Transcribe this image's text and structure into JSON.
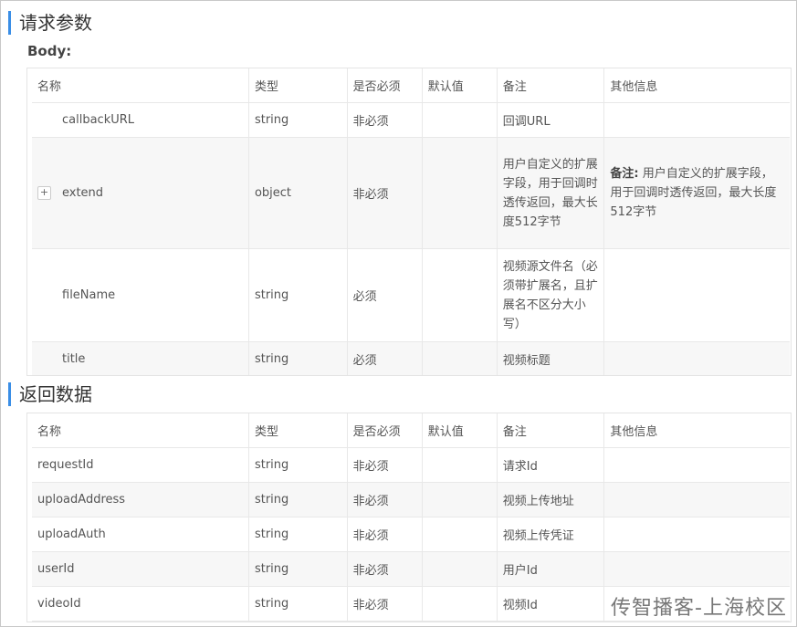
{
  "request": {
    "title": "请求参数",
    "body_label": "Body:",
    "headers": [
      "名称",
      "类型",
      "是否必须",
      "默认值",
      "备注",
      "其他信息"
    ],
    "rows": [
      {
        "name": "callbackURL",
        "type": "string",
        "required": "非必须",
        "default": "",
        "note": "回调URL",
        "other_label": "",
        "other": ""
      },
      {
        "name": "extend",
        "type": "object",
        "required": "非必须",
        "default": "",
        "note": "用户自定义的扩展字段，用于回调时透传返回，最大长度512字节",
        "other_label": "备注:",
        "other": " 用户自定义的扩展字段，用于回调时透传返回，最大长度512字节"
      },
      {
        "name": "fileName",
        "type": "string",
        "required": "必须",
        "default": "",
        "note": "视频源文件名（必须带扩展名，且扩展名不区分大小写）",
        "other_label": "",
        "other": ""
      },
      {
        "name": "title",
        "type": "string",
        "required": "必须",
        "default": "",
        "note": "视频标题",
        "other_label": "",
        "other": ""
      }
    ],
    "expand_symbol": "+"
  },
  "response": {
    "title": "返回数据",
    "headers": [
      "名称",
      "类型",
      "是否必须",
      "默认值",
      "备注",
      "其他信息"
    ],
    "rows": [
      {
        "name": "requestId",
        "type": "string",
        "required": "非必须",
        "default": "",
        "note": "请求Id",
        "other": ""
      },
      {
        "name": "uploadAddress",
        "type": "string",
        "required": "非必须",
        "default": "",
        "note": "视频上传地址",
        "other": ""
      },
      {
        "name": "uploadAuth",
        "type": "string",
        "required": "非必须",
        "default": "",
        "note": "视频上传凭证",
        "other": ""
      },
      {
        "name": "userId",
        "type": "string",
        "required": "非必须",
        "default": "",
        "note": "用户Id",
        "other": ""
      },
      {
        "name": "videoId",
        "type": "string",
        "required": "非必须",
        "default": "",
        "note": "视频Id",
        "other": ""
      }
    ]
  },
  "watermark": "传智播客-上海校区",
  "colors": {
    "accent": "#3a8ee6",
    "alt_row": "#f7f7f7",
    "border": "#e8e8e8"
  }
}
